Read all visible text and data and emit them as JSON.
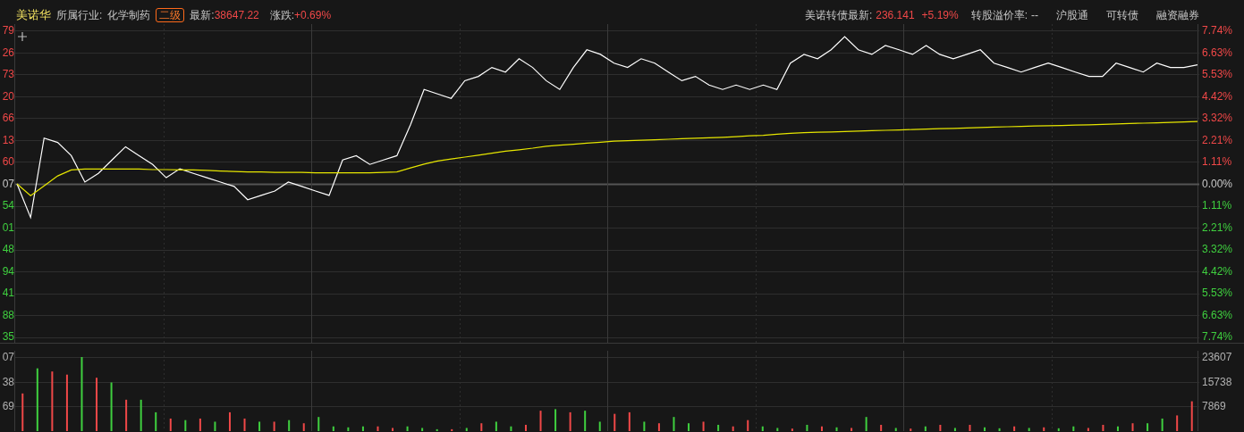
{
  "header": {
    "stock_name": "美诺华",
    "industry_label": "所属行业:",
    "industry": "化学制药",
    "level_badge": "二级",
    "latest_label": "最新:",
    "latest": "38647.22",
    "change_label": "涨跌:",
    "change": "+0.69%",
    "bond_label": "美诺转债最新:",
    "bond_price": "236.141",
    "bond_change": "+5.19%",
    "premium_label": "转股溢价率:",
    "premium": "--",
    "links": [
      "沪股通",
      "可转债",
      "融资融券"
    ]
  },
  "price_chart": {
    "left_labels": [
      "79",
      "26",
      "73",
      "20",
      "66",
      "13",
      "60",
      "07",
      "54",
      "01",
      "48",
      "94",
      "41",
      "88",
      "35"
    ],
    "chart_data": {
      "type": "line",
      "grid": true,
      "ylim": [
        -7.74,
        7.74
      ],
      "yticks": [
        {
          "value": 7.74,
          "label": "7.74%"
        },
        {
          "value": 6.63,
          "label": "6.63%"
        },
        {
          "value": 5.53,
          "label": "5.53%"
        },
        {
          "value": 4.42,
          "label": "4.42%"
        },
        {
          "value": 3.32,
          "label": "3.32%"
        },
        {
          "value": 2.21,
          "label": "2.21%"
        },
        {
          "value": 1.11,
          "label": "1.11%"
        },
        {
          "value": 0,
          "label": "0.00%"
        },
        {
          "value": -1.11,
          "label": "1.11%"
        },
        {
          "value": -2.21,
          "label": "2.21%"
        },
        {
          "value": -3.32,
          "label": "3.32%"
        },
        {
          "value": -4.42,
          "label": "4.42%"
        },
        {
          "value": -5.53,
          "label": "5.53%"
        },
        {
          "value": -6.63,
          "label": "6.63%"
        },
        {
          "value": -7.74,
          "label": "7.74%"
        }
      ],
      "series": [
        {
          "color": "#ffffff",
          "values": [
            0,
            -1.69,
            2.31,
            2.09,
            1.42,
            0.09,
            0.53,
            1.2,
            1.87,
            1.42,
            0.98,
            0.31,
            0.76,
            0.53,
            0.31,
            0.09,
            -0.13,
            -0.8,
            -0.58,
            -0.36,
            0.09,
            -0.13,
            -0.36,
            -0.58,
            1.2,
            1.42,
            0.98,
            1.2,
            1.42,
            2.98,
            4.76,
            4.53,
            4.31,
            5.2,
            5.42,
            5.87,
            5.64,
            6.31,
            5.87,
            5.2,
            4.76,
            5.87,
            6.76,
            6.53,
            6.09,
            5.87,
            6.31,
            6.09,
            5.64,
            5.2,
            5.42,
            4.98,
            4.76,
            4.98,
            4.76,
            4.98,
            4.76,
            6.09,
            6.53,
            6.31,
            6.76,
            7.42,
            6.76,
            6.53,
            6.98,
            6.76,
            6.53,
            6.98,
            6.53,
            6.31,
            6.53,
            6.76,
            6.09,
            5.87,
            5.64,
            5.87,
            6.09,
            5.87,
            5.64,
            5.42,
            5.42,
            6.09,
            5.87,
            5.64,
            6.09,
            5.87,
            5.87,
            6.0
          ]
        },
        {
          "color": "#e6e600",
          "values": [
            0,
            -0.6,
            -0.1,
            0.4,
            0.7,
            0.75,
            0.75,
            0.75,
            0.75,
            0.75,
            0.72,
            0.72,
            0.7,
            0.7,
            0.68,
            0.65,
            0.62,
            0.6,
            0.6,
            0.58,
            0.58,
            0.58,
            0.56,
            0.56,
            0.56,
            0.56,
            0.56,
            0.58,
            0.6,
            0.8,
            1.0,
            1.15,
            1.25,
            1.35,
            1.45,
            1.55,
            1.65,
            1.72,
            1.8,
            1.9,
            1.95,
            2.0,
            2.05,
            2.1,
            2.15,
            2.18,
            2.2,
            2.22,
            2.25,
            2.28,
            2.3,
            2.32,
            2.35,
            2.38,
            2.42,
            2.45,
            2.5,
            2.55,
            2.58,
            2.6,
            2.62,
            2.64,
            2.66,
            2.68,
            2.7,
            2.72,
            2.74,
            2.76,
            2.78,
            2.8,
            2.82,
            2.84,
            2.86,
            2.88,
            2.9,
            2.92,
            2.93,
            2.94,
            2.96,
            2.98,
            3.0,
            3.02,
            3.04,
            3.06,
            3.08,
            3.1,
            3.12,
            3.14
          ]
        }
      ]
    }
  },
  "volume_chart": {
    "left_labels": [
      "07",
      "38",
      "69"
    ],
    "chart_data": {
      "type": "bar",
      "grid": true,
      "stacked": true,
      "ylim": [
        0,
        23607
      ],
      "yticks": [
        {
          "value": 23607,
          "label": "23607"
        },
        {
          "value": 15738,
          "label": "15738"
        },
        {
          "value": 7869,
          "label": "7869"
        }
      ],
      "series": [
        {
          "color": "#f04848",
          "values": [
            12000,
            null,
            19000,
            18000,
            null,
            17000,
            null,
            10000,
            null,
            null,
            4000,
            null,
            4000,
            null,
            6000,
            4000,
            null,
            3000,
            null,
            2500,
            null,
            null,
            null,
            null,
            1500,
            1000,
            null,
            null,
            null,
            600,
            null,
            2500,
            null,
            null,
            2000,
            6500,
            null,
            6000,
            null,
            null,
            5500,
            6000,
            null,
            2500,
            null,
            null,
            3000,
            null,
            1500,
            3500,
            null,
            null,
            800,
            null,
            1500,
            null,
            1000,
            null,
            2000,
            null,
            800,
            null,
            2000,
            null,
            2000,
            null,
            null,
            1500,
            null,
            1200,
            null,
            null,
            1000,
            2000,
            null,
            2500,
            null,
            null,
            5000,
            9500
          ]
        },
        {
          "color": "#3fcf3f",
          "values": [
            null,
            20000,
            null,
            null,
            23600,
            null,
            15500,
            null,
            10000,
            6000,
            null,
            3500,
            null,
            3000,
            null,
            null,
            3000,
            null,
            3500,
            null,
            4500,
            1500,
            1200,
            1500,
            null,
            null,
            1500,
            1000,
            600,
            null,
            1000,
            null,
            3000,
            1500,
            null,
            null,
            7000,
            null,
            6500,
            3000,
            null,
            null,
            3000,
            null,
            4500,
            2500,
            null,
            2000,
            null,
            null,
            1500,
            1000,
            null,
            2000,
            null,
            1200,
            null,
            4500,
            null,
            1000,
            null,
            1500,
            null,
            1000,
            null,
            1200,
            900,
            null,
            1000,
            null,
            900,
            1500,
            null,
            null,
            1500,
            null,
            2500,
            4000,
            null,
            null
          ]
        }
      ]
    }
  }
}
